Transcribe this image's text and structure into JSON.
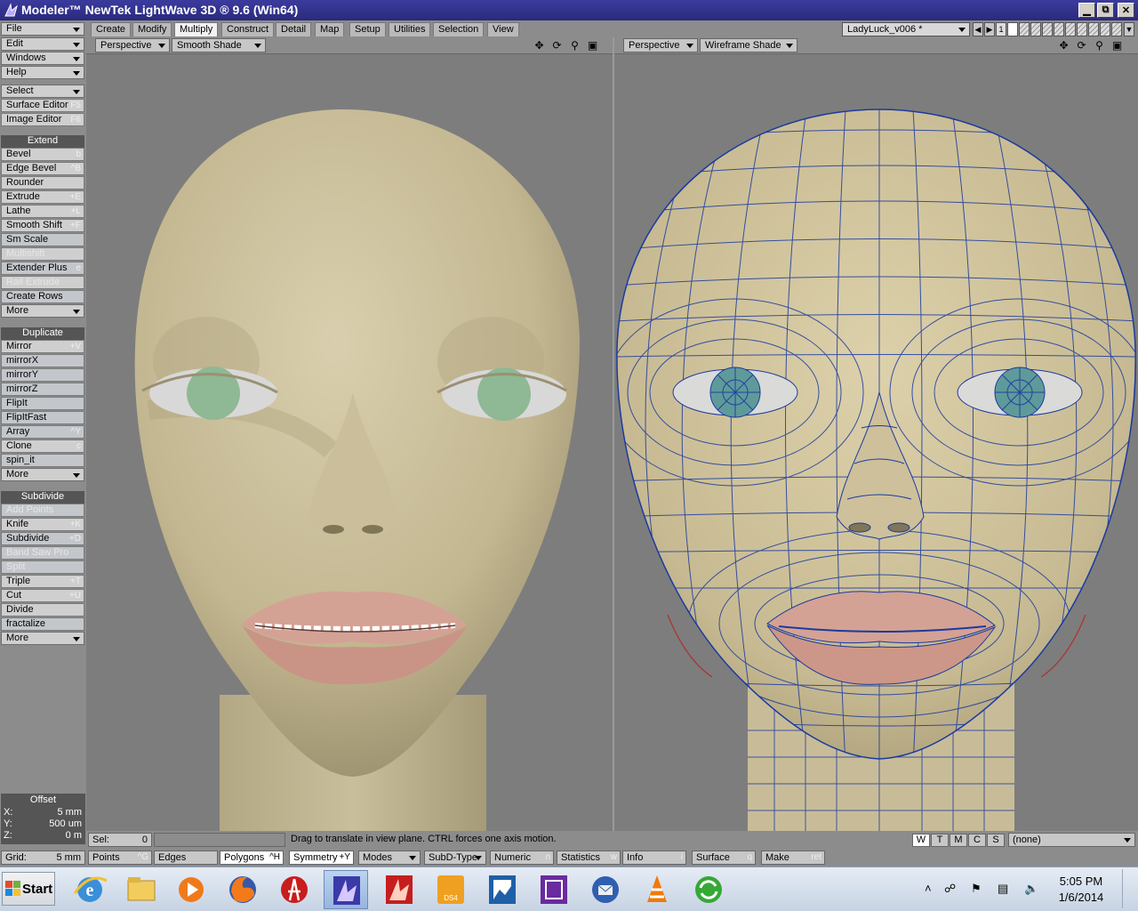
{
  "title_bar": {
    "title": "Modeler™ NewTek LightWave 3D ® 9.6  (Win64)",
    "minimize": "▁",
    "restore": "⧉",
    "close": "✕"
  },
  "menus": {
    "file": "File",
    "edit": "Edit",
    "windows": "Windows",
    "help": "Help"
  },
  "tabs": [
    "Create",
    "Modify",
    "Multiply",
    "Construct",
    "Detail",
    "Map",
    "Setup",
    "Utilities",
    "Selection",
    "View"
  ],
  "active_tab": "Multiply",
  "object_selector": "LadyLuck_v006 *",
  "layers": {
    "number": "1"
  },
  "sidebar": {
    "select": "Select",
    "surface_editor": {
      "label": "Surface Editor",
      "shortcut": "F5"
    },
    "image_editor": {
      "label": "Image Editor",
      "shortcut": "F6"
    },
    "extend_header": "Extend",
    "extend": [
      {
        "label": "Bevel",
        "shortcut": "b"
      },
      {
        "label": "Edge Bevel",
        "shortcut": "^B"
      },
      {
        "label": "Rounder",
        "shortcut": ""
      },
      {
        "label": "Extrude",
        "shortcut": "+E"
      },
      {
        "label": "Lathe",
        "shortcut": "+L"
      },
      {
        "label": "Smooth Shift",
        "shortcut": "+F"
      },
      {
        "label": "Sm Scale",
        "shortcut": ""
      },
      {
        "label": "Multishift",
        "shortcut": ""
      },
      {
        "label": "Extender Plus",
        "shortcut": "e"
      },
      {
        "label": "Rail Extrude",
        "shortcut": ""
      },
      {
        "label": "Create Rows",
        "shortcut": ""
      }
    ],
    "extend_more": "More",
    "duplicate_header": "Duplicate",
    "duplicate": [
      {
        "label": "Mirror",
        "shortcut": "+V"
      },
      {
        "label": "mirrorX",
        "shortcut": ""
      },
      {
        "label": "mirrorY",
        "shortcut": ""
      },
      {
        "label": "mirrorZ",
        "shortcut": ""
      },
      {
        "label": "FlipIt",
        "shortcut": ""
      },
      {
        "label": "FlipItFast",
        "shortcut": ""
      },
      {
        "label": "Array",
        "shortcut": "^Y"
      },
      {
        "label": "Clone",
        "shortcut": "c"
      },
      {
        "label": "spin_it",
        "shortcut": ""
      }
    ],
    "duplicate_more": "More",
    "subdivide_header": "Subdivide",
    "subdivide": [
      {
        "label": "Add Points",
        "shortcut": ""
      },
      {
        "label": "Knife",
        "shortcut": "+K"
      },
      {
        "label": "Subdivide",
        "shortcut": "+D"
      },
      {
        "label": "Band Saw Pro",
        "shortcut": ""
      },
      {
        "label": "Split",
        "shortcut": ""
      },
      {
        "label": "Triple",
        "shortcut": "+T"
      },
      {
        "label": "Cut",
        "shortcut": "+U"
      },
      {
        "label": "Divide",
        "shortcut": ""
      },
      {
        "label": "fractalize",
        "shortcut": ""
      }
    ],
    "subdivide_more": "More",
    "offset": {
      "title": "Offset",
      "x_label": "X:",
      "x": "5 mm",
      "y_label": "Y:",
      "y": "500 um",
      "z_label": "Z:",
      "z": "0 m"
    },
    "grid_label": "Grid:",
    "grid_value": "5 mm"
  },
  "viewport_left": {
    "view": "Perspective",
    "shading": "Smooth Shade"
  },
  "viewport_right": {
    "view": "Perspective",
    "shading": "Wireframe Shade"
  },
  "viewport_icons": [
    "move-view-icon",
    "rotate-view-icon",
    "zoom-view-icon",
    "maximize-view-icon"
  ],
  "status": {
    "sel_label": "Sel:",
    "sel_value": "0",
    "hint": "Drag to translate in view plane. CTRL forces one axis motion.",
    "wtmcs": [
      "W",
      "T",
      "M",
      "C",
      "S"
    ],
    "surface_dropdown": "(none)"
  },
  "bottom_bar": {
    "points": {
      "label": "Points",
      "shortcut": "^G"
    },
    "edges": {
      "label": "Edges",
      "shortcut": ""
    },
    "polygons": {
      "label": "Polygons",
      "shortcut": "^H"
    },
    "symmetry": {
      "label": "Symmetry",
      "shortcut": "+Y"
    },
    "modes": "Modes",
    "subd_type": "SubD-Type",
    "numeric": {
      "label": "Numeric",
      "shortcut": "n"
    },
    "statistics": {
      "label": "Statistics",
      "shortcut": "w"
    },
    "info": {
      "label": "Info",
      "shortcut": "i"
    },
    "surface": {
      "label": "Surface",
      "shortcut": "q"
    },
    "make": {
      "label": "Make",
      "shortcut": "ret"
    }
  },
  "taskbar": {
    "start": "Start",
    "apps": [
      "internet-explorer",
      "file-explorer",
      "media-player",
      "firefox",
      "acrobat",
      "lightwave-modeler",
      "lightwave-layout",
      "ds4",
      "photo-viewer",
      "video-editor",
      "thunderbird",
      "vlc",
      "sync"
    ],
    "clock_time": "5:05 PM",
    "clock_date": "1/6/2014"
  },
  "colors": {
    "skin": "#c8bc98",
    "lips": "#d4a294",
    "wire": "#1a3aa0",
    "viewport_bg": "#7d7d7d",
    "panel_bg": "#8c8c8c",
    "button_bg": "#cfcfcf"
  }
}
